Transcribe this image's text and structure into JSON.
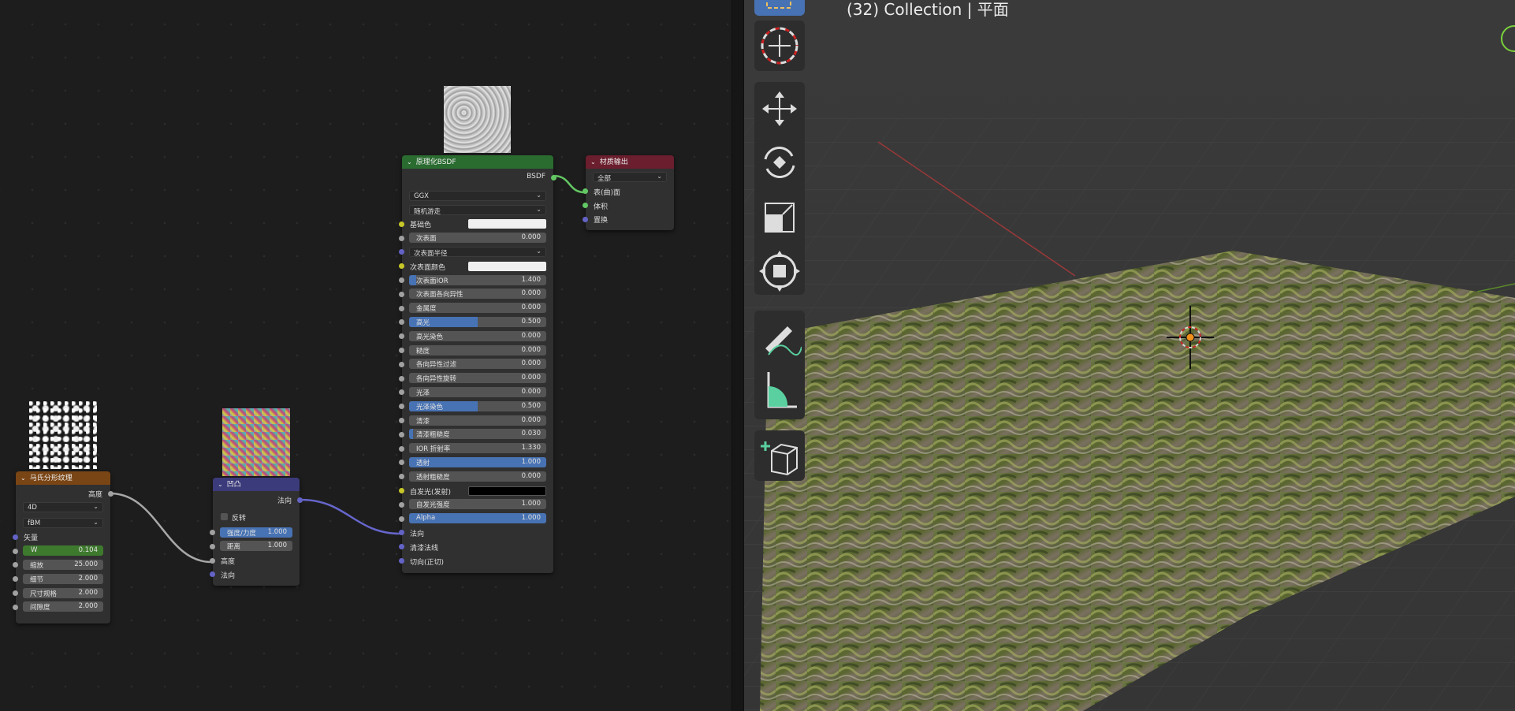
{
  "viewport": {
    "title": "(32) Collection | 平面"
  },
  "nodes": {
    "musgrave": {
      "title": "马氏分形纹理",
      "output": "高度",
      "dim_option": "4D",
      "type_option": "fBM",
      "vector": "矢量",
      "fields": [
        {
          "name": "W",
          "value": "0.104"
        },
        {
          "name": "缩放",
          "value": "25.000"
        },
        {
          "name": "细节",
          "value": "2.000"
        },
        {
          "name": "尺寸规格",
          "value": "2.000"
        },
        {
          "name": "间隙度",
          "value": "2.000"
        }
      ]
    },
    "bump": {
      "title": "凹凸",
      "output": "法向",
      "invert": "反转",
      "fields": [
        {
          "name": "强度/力度",
          "value": "1.000",
          "fill": 1.0
        },
        {
          "name": "距离",
          "value": "1.000",
          "fill": 0
        }
      ],
      "inputs": [
        "高度",
        "法向"
      ]
    },
    "bsdf": {
      "title": "原理化BSDF",
      "output": "BSDF",
      "distribution": "GGX",
      "subsurface_method": "随机游走",
      "base_color": "基础色",
      "subsurface": {
        "name": "次表面",
        "value": "0.000"
      },
      "subsurface_radius": "次表面半径",
      "subsurface_color": "次表面颜色",
      "fields": [
        {
          "name": "次表面IOR",
          "value": "1.400",
          "fill": 0.05
        },
        {
          "name": "次表面各向异性",
          "value": "0.000",
          "fill": 0
        },
        {
          "name": "金属度",
          "value": "0.000",
          "fill": 0
        },
        {
          "name": "高光",
          "value": "0.500",
          "fill": 0.5
        },
        {
          "name": "高光染色",
          "value": "0.000",
          "fill": 0
        },
        {
          "name": "糙度",
          "value": "0.000",
          "fill": 0
        },
        {
          "name": "各向异性过滤",
          "value": "0.000",
          "fill": 0
        },
        {
          "name": "各向异性旋转",
          "value": "0.000",
          "fill": 0
        },
        {
          "name": "光泽",
          "value": "0.000",
          "fill": 0
        },
        {
          "name": "光泽染色",
          "value": "0.500",
          "fill": 0.5
        },
        {
          "name": "清漆",
          "value": "0.000",
          "fill": 0
        },
        {
          "name": "清漆粗糙度",
          "value": "0.030",
          "fill": 0.03
        },
        {
          "name": "IOR 折射率",
          "value": "1.330",
          "fill": 0
        },
        {
          "name": "透射",
          "value": "1.000",
          "fill": 1.0
        },
        {
          "name": "透射粗糙度",
          "value": "0.000",
          "fill": 0
        }
      ],
      "emission": "自发光(发射)",
      "emission_strength": {
        "name": "自发光强度",
        "value": "1.000"
      },
      "alpha": {
        "name": "Alpha",
        "value": "1.000",
        "fill": 1.0
      },
      "inputs": [
        "法向",
        "清漆法线",
        "切向(正切)"
      ]
    },
    "output": {
      "title": "材质输出",
      "target": "全部",
      "inputs": [
        "表(曲)面",
        "体积",
        "置换"
      ]
    }
  },
  "colors": {
    "bsdf_header": "#2a6b30",
    "output_header": "#6b1e2d",
    "musgrave_header": "#7a4514",
    "bump_header": "#3b3a7a",
    "field_fill": "#4772b3",
    "socket_gray": "#a1a1a1",
    "socket_yellow": "#c7c729",
    "socket_purple": "#6363c7",
    "socket_green": "#63c763"
  },
  "toolbar": {
    "tools": [
      "select-box-icon",
      "cursor-icon",
      "move-icon",
      "rotate-icon",
      "scale-icon",
      "transform-icon",
      "annotate-icon",
      "measure-icon",
      "add-cube-icon"
    ]
  }
}
